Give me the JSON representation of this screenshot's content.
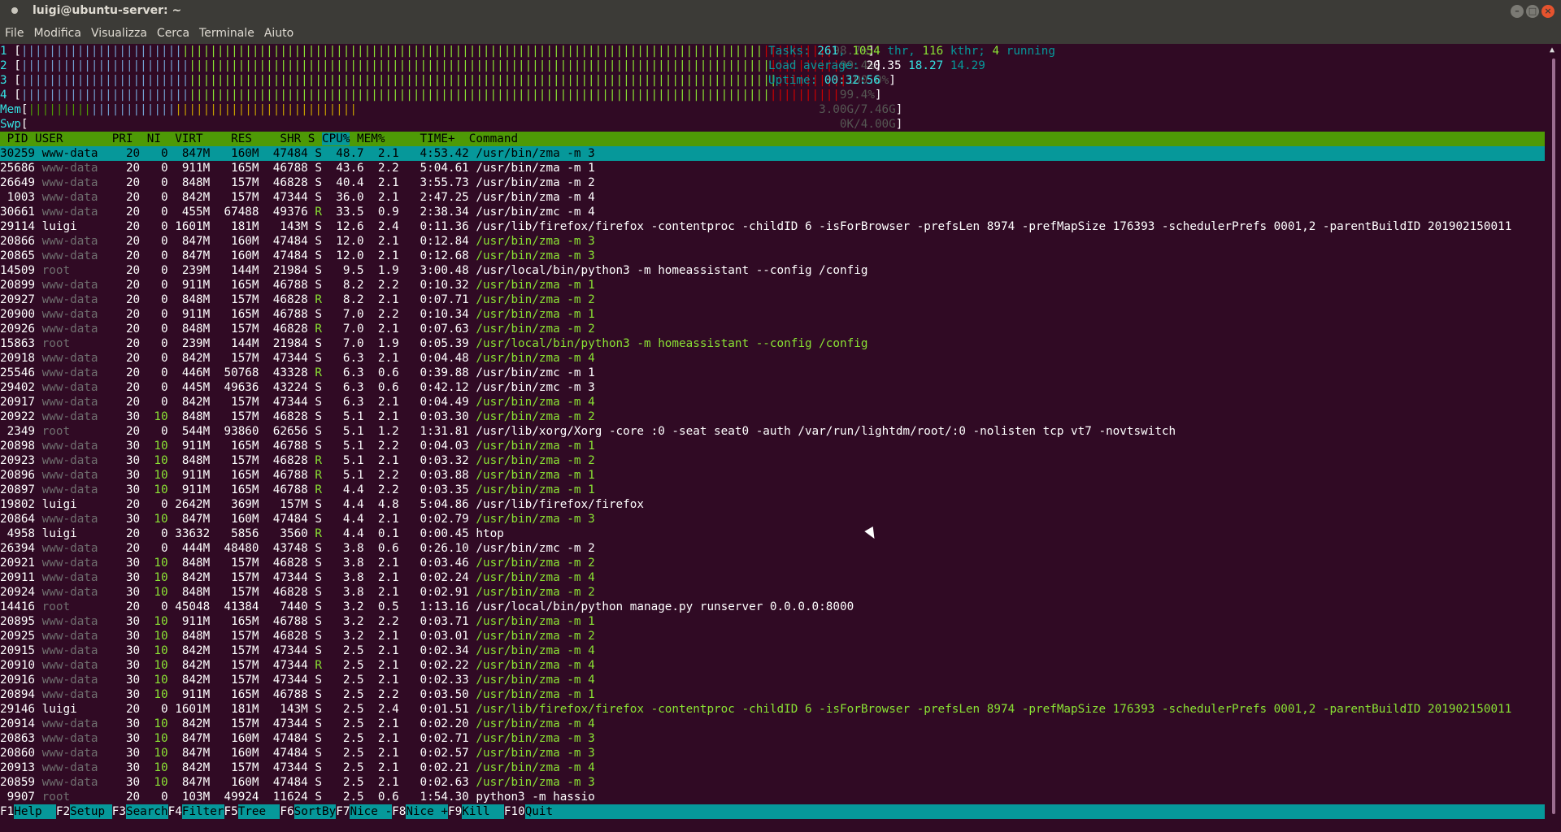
{
  "window": {
    "title": "luigi@ubuntu-server: ~",
    "buttons": [
      "minimize",
      "maximize",
      "close"
    ]
  },
  "menu": [
    "File",
    "Modifica",
    "Visualizza",
    "Cerca",
    "Terminale",
    "Aiuto"
  ],
  "meters": {
    "cpus": [
      {
        "id": "1",
        "percent": "98.7%"
      },
      {
        "id": "2",
        "percent": "99.4%"
      },
      {
        "id": "3",
        "percent": "100.0%"
      },
      {
        "id": "4",
        "percent": "99.4%"
      }
    ],
    "mem": {
      "label": "Mem",
      "value": "3.00G/7.46G",
      "fraction": 0.4
    },
    "swp": {
      "label": "Swp",
      "value": "0K/4.00G",
      "fraction": 0.0
    }
  },
  "summary": {
    "tasks_label": "Tasks: ",
    "tasks": "261",
    "thr": "1054",
    "thr_label": " thr, ",
    "kthr": "116",
    "kthr_label": " kthr; ",
    "running": "4",
    "running_label": " running",
    "load_label": "Load average: ",
    "load1": "20.35",
    "load5": "18.27",
    "load15": "14.29",
    "uptime_label": "Uptime: ",
    "uptime": "00:32:56"
  },
  "columns": [
    "PID",
    "USER",
    "PRI",
    "NI",
    "VIRT",
    "RES",
    "SHR",
    "S",
    "CPU%",
    "MEM%",
    "TIME+",
    "Command"
  ],
  "sorted_column": "CPU%",
  "processes": [
    [
      "30259",
      "www-data",
      "20",
      "0",
      "847M",
      "160M",
      "47484",
      "S",
      "48.7",
      "2.1",
      "4:53.42",
      "/usr/bin/zma -m 3",
      "main"
    ],
    [
      "25686",
      "www-data",
      "20",
      "0",
      "911M",
      "165M",
      "46788",
      "S",
      "43.6",
      "2.2",
      "5:04.61",
      "/usr/bin/zma -m 1",
      "main"
    ],
    [
      "26649",
      "www-data",
      "20",
      "0",
      "848M",
      "157M",
      "46828",
      "S",
      "40.4",
      "2.1",
      "3:55.73",
      "/usr/bin/zma -m 2",
      "main"
    ],
    [
      "1003",
      "www-data",
      "20",
      "0",
      "842M",
      "157M",
      "47344",
      "S",
      "36.0",
      "2.1",
      "2:47.25",
      "/usr/bin/zma -m 4",
      "main"
    ],
    [
      "30661",
      "www-data",
      "20",
      "0",
      "455M",
      "67488",
      "49376",
      "R",
      "33.5",
      "0.9",
      "2:38.34",
      "/usr/bin/zmc -m 4",
      "main"
    ],
    [
      "29114",
      "luigi",
      "20",
      "0",
      "1601M",
      "181M",
      "143M",
      "S",
      "12.6",
      "2.4",
      "0:11.36",
      "/usr/lib/firefox/firefox -contentproc -childID 6 -isForBrowser -prefsLen 8974 -prefMapSize 176393 -schedulerPrefs 0001,2 -parentBuildID 201902150011",
      "main"
    ],
    [
      "20866",
      "www-data",
      "20",
      "0",
      "847M",
      "160M",
      "47484",
      "S",
      "12.0",
      "2.1",
      "0:12.84",
      "/usr/bin/zma -m 3",
      "thread"
    ],
    [
      "20865",
      "www-data",
      "20",
      "0",
      "847M",
      "160M",
      "47484",
      "S",
      "12.0",
      "2.1",
      "0:12.68",
      "/usr/bin/zma -m 3",
      "thread"
    ],
    [
      "14509",
      "root",
      "20",
      "0",
      "239M",
      "144M",
      "21984",
      "S",
      "9.5",
      "1.9",
      "3:00.48",
      "/usr/local/bin/python3 -m homeassistant --config /config",
      "main"
    ],
    [
      "20899",
      "www-data",
      "20",
      "0",
      "911M",
      "165M",
      "46788",
      "S",
      "8.2",
      "2.2",
      "0:10.32",
      "/usr/bin/zma -m 1",
      "thread"
    ],
    [
      "20927",
      "www-data",
      "20",
      "0",
      "848M",
      "157M",
      "46828",
      "R",
      "8.2",
      "2.1",
      "0:07.71",
      "/usr/bin/zma -m 2",
      "thread"
    ],
    [
      "20900",
      "www-data",
      "20",
      "0",
      "911M",
      "165M",
      "46788",
      "S",
      "7.0",
      "2.2",
      "0:10.34",
      "/usr/bin/zma -m 1",
      "thread"
    ],
    [
      "20926",
      "www-data",
      "20",
      "0",
      "848M",
      "157M",
      "46828",
      "R",
      "7.0",
      "2.1",
      "0:07.63",
      "/usr/bin/zma -m 2",
      "thread"
    ],
    [
      "15863",
      "root",
      "20",
      "0",
      "239M",
      "144M",
      "21984",
      "S",
      "7.0",
      "1.9",
      "0:05.39",
      "/usr/local/bin/python3 -m homeassistant --config /config",
      "thread"
    ],
    [
      "20918",
      "www-data",
      "20",
      "0",
      "842M",
      "157M",
      "47344",
      "S",
      "6.3",
      "2.1",
      "0:04.48",
      "/usr/bin/zma -m 4",
      "thread"
    ],
    [
      "25546",
      "www-data",
      "20",
      "0",
      "446M",
      "50768",
      "43328",
      "R",
      "6.3",
      "0.6",
      "0:39.88",
      "/usr/bin/zmc -m 1",
      "main"
    ],
    [
      "29402",
      "www-data",
      "20",
      "0",
      "445M",
      "49636",
      "43224",
      "S",
      "6.3",
      "0.6",
      "0:42.12",
      "/usr/bin/zmc -m 3",
      "main"
    ],
    [
      "20917",
      "www-data",
      "20",
      "0",
      "842M",
      "157M",
      "47344",
      "S",
      "6.3",
      "2.1",
      "0:04.49",
      "/usr/bin/zma -m 4",
      "thread"
    ],
    [
      "20922",
      "www-data",
      "30",
      "10",
      "848M",
      "157M",
      "46828",
      "S",
      "5.1",
      "2.1",
      "0:03.30",
      "/usr/bin/zma -m 2",
      "thread"
    ],
    [
      "2349",
      "root",
      "20",
      "0",
      "544M",
      "93860",
      "62656",
      "S",
      "5.1",
      "1.2",
      "1:31.81",
      "/usr/lib/xorg/Xorg -core :0 -seat seat0 -auth /var/run/lightdm/root/:0 -nolisten tcp vt7 -novtswitch",
      "main"
    ],
    [
      "20898",
      "www-data",
      "30",
      "10",
      "911M",
      "165M",
      "46788",
      "S",
      "5.1",
      "2.2",
      "0:04.03",
      "/usr/bin/zma -m 1",
      "thread"
    ],
    [
      "20923",
      "www-data",
      "30",
      "10",
      "848M",
      "157M",
      "46828",
      "R",
      "5.1",
      "2.1",
      "0:03.32",
      "/usr/bin/zma -m 2",
      "thread"
    ],
    [
      "20896",
      "www-data",
      "30",
      "10",
      "911M",
      "165M",
      "46788",
      "R",
      "5.1",
      "2.2",
      "0:03.88",
      "/usr/bin/zma -m 1",
      "thread"
    ],
    [
      "20897",
      "www-data",
      "30",
      "10",
      "911M",
      "165M",
      "46788",
      "R",
      "4.4",
      "2.2",
      "0:03.35",
      "/usr/bin/zma -m 1",
      "thread"
    ],
    [
      "19802",
      "luigi",
      "20",
      "0",
      "2642M",
      "369M",
      "157M",
      "S",
      "4.4",
      "4.8",
      "5:04.86",
      "/usr/lib/firefox/firefox",
      "main"
    ],
    [
      "20864",
      "www-data",
      "30",
      "10",
      "847M",
      "160M",
      "47484",
      "S",
      "4.4",
      "2.1",
      "0:02.79",
      "/usr/bin/zma -m 3",
      "thread"
    ],
    [
      "4958",
      "luigi",
      "20",
      "0",
      "33632",
      "5856",
      "3560",
      "R",
      "4.4",
      "0.1",
      "0:00.45",
      "htop",
      "main"
    ],
    [
      "26394",
      "www-data",
      "20",
      "0",
      "444M",
      "48480",
      "43748",
      "S",
      "3.8",
      "0.6",
      "0:26.10",
      "/usr/bin/zmc -m 2",
      "main"
    ],
    [
      "20921",
      "www-data",
      "30",
      "10",
      "848M",
      "157M",
      "46828",
      "S",
      "3.8",
      "2.1",
      "0:03.46",
      "/usr/bin/zma -m 2",
      "thread"
    ],
    [
      "20911",
      "www-data",
      "30",
      "10",
      "842M",
      "157M",
      "47344",
      "S",
      "3.8",
      "2.1",
      "0:02.24",
      "/usr/bin/zma -m 4",
      "thread"
    ],
    [
      "20924",
      "www-data",
      "30",
      "10",
      "848M",
      "157M",
      "46828",
      "S",
      "3.8",
      "2.1",
      "0:02.91",
      "/usr/bin/zma -m 2",
      "thread"
    ],
    [
      "14416",
      "root",
      "20",
      "0",
      "45048",
      "41384",
      "7440",
      "S",
      "3.2",
      "0.5",
      "1:13.16",
      "/usr/local/bin/python manage.py runserver 0.0.0.0:8000",
      "main"
    ],
    [
      "20895",
      "www-data",
      "30",
      "10",
      "911M",
      "165M",
      "46788",
      "S",
      "3.2",
      "2.2",
      "0:03.71",
      "/usr/bin/zma -m 1",
      "thread"
    ],
    [
      "20925",
      "www-data",
      "30",
      "10",
      "848M",
      "157M",
      "46828",
      "S",
      "3.2",
      "2.1",
      "0:03.01",
      "/usr/bin/zma -m 2",
      "thread"
    ],
    [
      "20915",
      "www-data",
      "30",
      "10",
      "842M",
      "157M",
      "47344",
      "S",
      "2.5",
      "2.1",
      "0:02.34",
      "/usr/bin/zma -m 4",
      "thread"
    ],
    [
      "20910",
      "www-data",
      "30",
      "10",
      "842M",
      "157M",
      "47344",
      "R",
      "2.5",
      "2.1",
      "0:02.22",
      "/usr/bin/zma -m 4",
      "thread"
    ],
    [
      "20916",
      "www-data",
      "30",
      "10",
      "842M",
      "157M",
      "47344",
      "S",
      "2.5",
      "2.1",
      "0:02.33",
      "/usr/bin/zma -m 4",
      "thread"
    ],
    [
      "20894",
      "www-data",
      "30",
      "10",
      "911M",
      "165M",
      "46788",
      "S",
      "2.5",
      "2.2",
      "0:03.50",
      "/usr/bin/zma -m 1",
      "thread"
    ],
    [
      "29146",
      "luigi",
      "20",
      "0",
      "1601M",
      "181M",
      "143M",
      "S",
      "2.5",
      "2.4",
      "0:01.51",
      "/usr/lib/firefox/firefox -contentproc -childID 6 -isForBrowser -prefsLen 8974 -prefMapSize 176393 -schedulerPrefs 0001,2 -parentBuildID 201902150011",
      "thread"
    ],
    [
      "20914",
      "www-data",
      "30",
      "10",
      "842M",
      "157M",
      "47344",
      "S",
      "2.5",
      "2.1",
      "0:02.20",
      "/usr/bin/zma -m 4",
      "thread"
    ],
    [
      "20863",
      "www-data",
      "30",
      "10",
      "847M",
      "160M",
      "47484",
      "S",
      "2.5",
      "2.1",
      "0:02.71",
      "/usr/bin/zma -m 3",
      "thread"
    ],
    [
      "20860",
      "www-data",
      "30",
      "10",
      "847M",
      "160M",
      "47484",
      "S",
      "2.5",
      "2.1",
      "0:02.57",
      "/usr/bin/zma -m 3",
      "thread"
    ],
    [
      "20913",
      "www-data",
      "30",
      "10",
      "842M",
      "157M",
      "47344",
      "S",
      "2.5",
      "2.1",
      "0:02.21",
      "/usr/bin/zma -m 4",
      "thread"
    ],
    [
      "20859",
      "www-data",
      "30",
      "10",
      "847M",
      "160M",
      "47484",
      "S",
      "2.5",
      "2.1",
      "0:02.63",
      "/usr/bin/zma -m 3",
      "thread"
    ],
    [
      "9907",
      "root",
      "20",
      "0",
      "103M",
      "49924",
      "11624",
      "S",
      "2.5",
      "0.6",
      "1:54.30",
      "python3 -m hassio",
      "main"
    ]
  ],
  "selected_row": 0,
  "footer": [
    {
      "key": "F1",
      "label": "Help  "
    },
    {
      "key": "F2",
      "label": "Setup "
    },
    {
      "key": "F3",
      "label": "Search"
    },
    {
      "key": "F4",
      "label": "Filter"
    },
    {
      "key": "F5",
      "label": "Tree  "
    },
    {
      "key": "F6",
      "label": "SortBy"
    },
    {
      "key": "F7",
      "label": "Nice -"
    },
    {
      "key": "F8",
      "label": "Nice +"
    },
    {
      "key": "F9",
      "label": "Kill  "
    },
    {
      "key": "F10",
      "label": "Quit"
    }
  ],
  "colors": {
    "terminal_bg": "#300a24",
    "header_bg": "#4e9a06",
    "selection_bg": "#06989a",
    "thread_fg": "#8ae234",
    "user_dim_fg": "#6f6f6f"
  }
}
